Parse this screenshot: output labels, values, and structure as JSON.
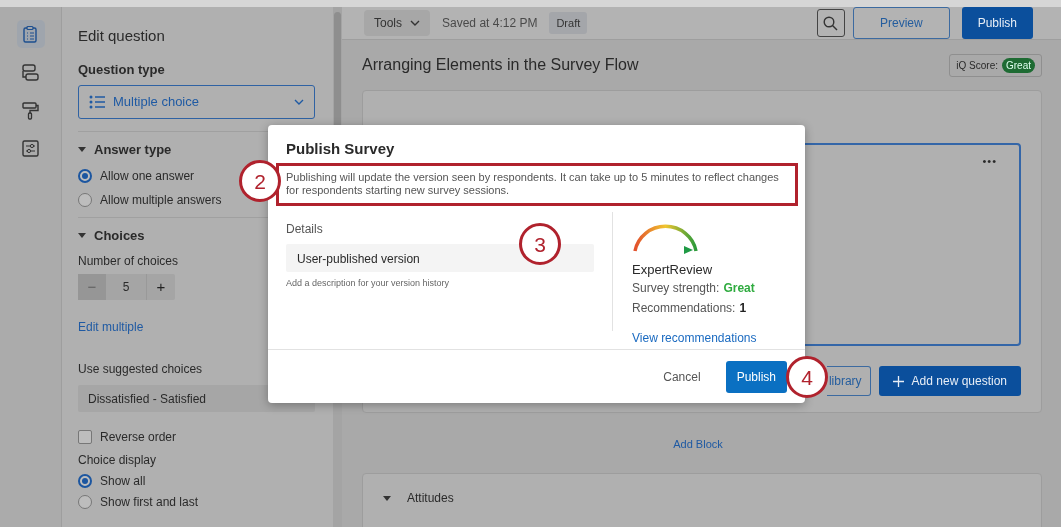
{
  "nav_rail": [
    {
      "kind": "survey",
      "selected": true
    },
    {
      "kind": "flow",
      "selected": false
    },
    {
      "kind": "look",
      "selected": false
    },
    {
      "kind": "options",
      "selected": false
    }
  ],
  "edit_panel": {
    "title": "Edit question",
    "question_type": {
      "label": "Question type",
      "value": "Multiple choice"
    },
    "answer_type": {
      "heading": "Answer type",
      "expanded": true,
      "options": [
        {
          "label": "Allow one answer",
          "selected": true
        },
        {
          "label": "Allow multiple answers",
          "selected": false
        }
      ]
    },
    "choices": {
      "heading": "Choices",
      "expanded": true,
      "count_label": "Number of choices",
      "decrement": "−",
      "decrement_disabled": true,
      "count": "5",
      "increment": "+",
      "edit_link": "Edit multiple",
      "suggested_label": "Use suggested choices",
      "suggested_value": "Dissatisfied - Satisfied",
      "reverse_order": {
        "label": "Reverse order",
        "checked": false
      },
      "display_label": "Choice display",
      "display_options": [
        {
          "label": "Show all",
          "selected": true
        },
        {
          "label": "Show first and last",
          "selected": false
        }
      ]
    }
  },
  "toolbar": {
    "tools": "Tools",
    "saved": "Saved at 4:12 PM",
    "status": "Draft",
    "preview": "Preview",
    "publish": "Publish"
  },
  "survey": {
    "title": "Arranging Elements in the Survey Flow",
    "iq_label": "iQ Score:",
    "iq_value": "Great",
    "question_menu": "•••",
    "library_button": "library",
    "add_question": "Add new question",
    "add_block": "Add Block",
    "block_title": "Attitudes",
    "block_expanded": true
  },
  "modal": {
    "title": "Publish Survey",
    "message": "Publishing will update the version seen by respondents. It can take up to 5 minutes to reflect changes for respondents starting new survey sessions.",
    "details_label": "Details",
    "version_name": "User-published version",
    "hint": "Add a description for your version history",
    "expert": {
      "title": "ExpertReview",
      "strength_label": "Survey strength:",
      "strength": "Great",
      "recommendations_label": "Recommendations:",
      "recommendations": "1",
      "link": "View recommendations"
    },
    "cancel": "Cancel",
    "publish": "Publish"
  },
  "callouts": [
    {
      "number": "2"
    },
    {
      "number": "3"
    },
    {
      "number": "4"
    }
  ]
}
